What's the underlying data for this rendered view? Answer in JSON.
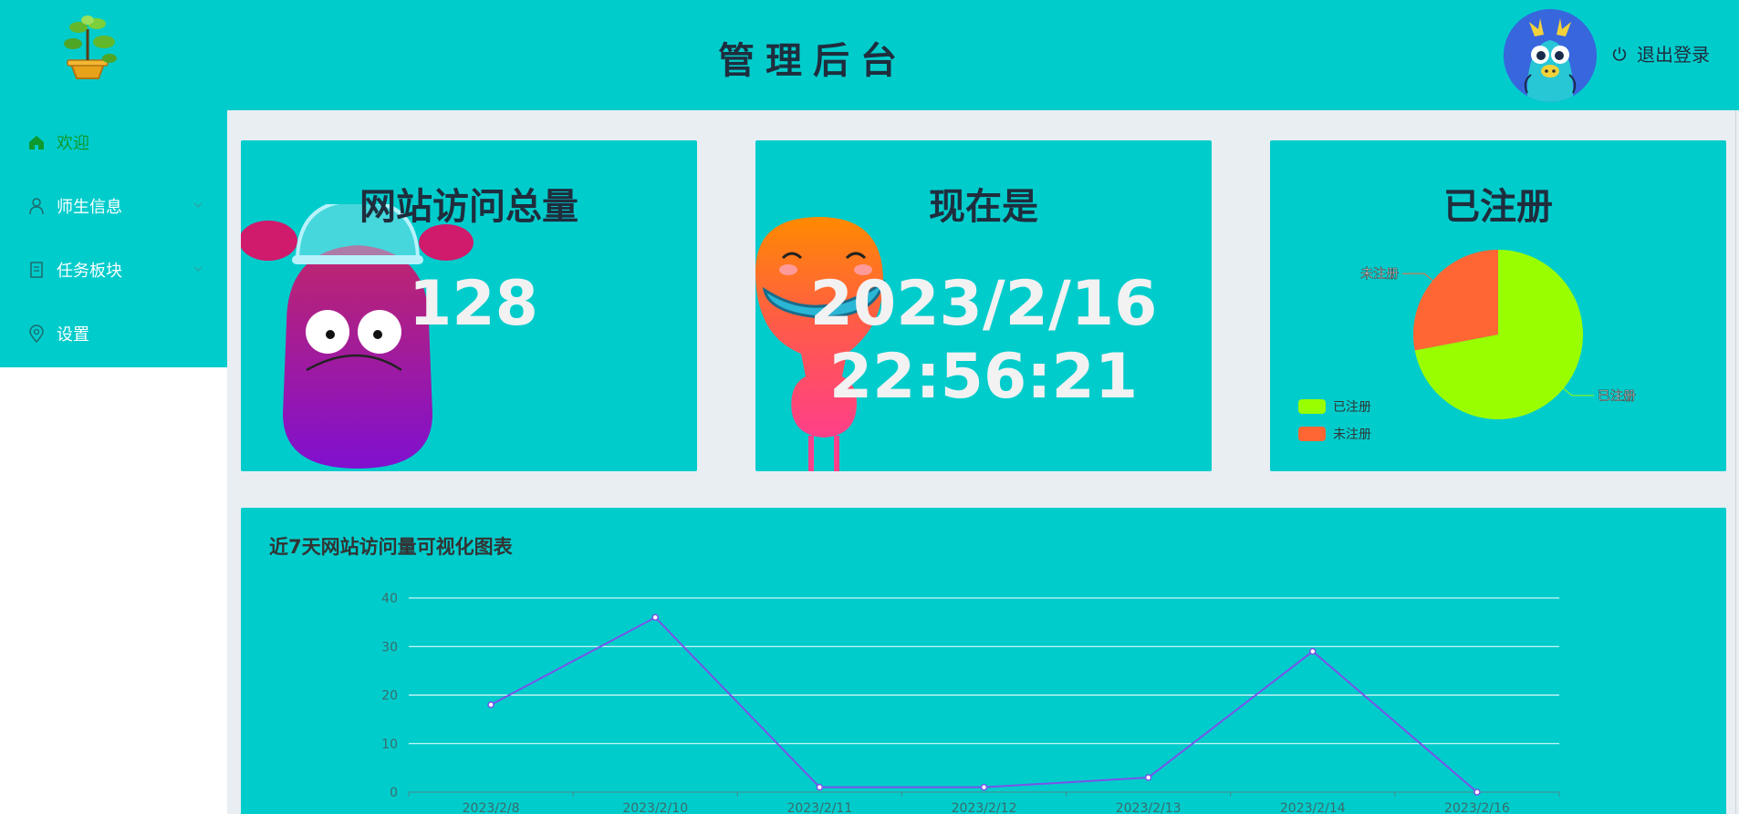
{
  "header": {
    "title": "管理后台",
    "logout_label": "退出登录"
  },
  "sidebar": {
    "items": [
      {
        "label": "欢迎",
        "icon": "home-icon",
        "active": true
      },
      {
        "label": "师生信息",
        "icon": "user-icon",
        "has_submenu": true
      },
      {
        "label": "任务板块",
        "icon": "document-icon",
        "has_submenu": true
      },
      {
        "label": "设置",
        "icon": "location-icon"
      }
    ]
  },
  "cards": {
    "visits": {
      "title": "网站访问总量",
      "value": "128"
    },
    "now": {
      "title": "现在是",
      "date": "2023/2/16",
      "time": "22:56:21"
    },
    "registered": {
      "title": "已注册"
    }
  },
  "pie_chart": {
    "type": "pie",
    "slices": [
      {
        "name": "已注册",
        "value": 72,
        "color": "#99ff00"
      },
      {
        "name": "未注册",
        "value": 28,
        "color": "#ff6633"
      }
    ],
    "legend": [
      "已注册",
      "未注册"
    ],
    "legend_placement": "bottom-left"
  },
  "chart_data": {
    "type": "line",
    "title": "近7天网站访问量可视化图表",
    "categories": [
      "2023/2/8",
      "2023/2/10",
      "2023/2/11",
      "2023/2/12",
      "2023/2/13",
      "2023/2/14",
      "2023/2/16"
    ],
    "values": [
      18,
      36,
      1,
      1,
      3,
      29,
      0
    ],
    "ylim": [
      0,
      40
    ],
    "yticks": [
      0,
      10,
      20,
      30,
      40
    ],
    "grid": true,
    "line_color": "#7b52e8"
  },
  "colors": {
    "accent": "#00cccc",
    "page_bg": "#e9eef3",
    "active_menu": "#0e9a2c"
  }
}
